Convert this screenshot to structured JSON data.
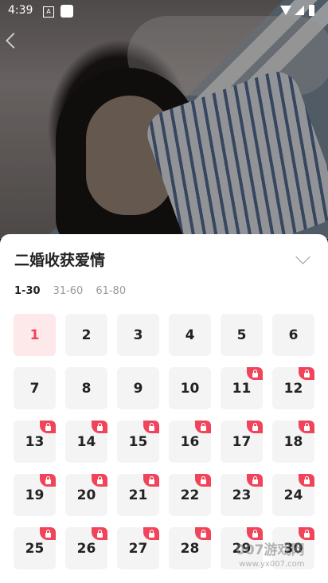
{
  "status_bar": {
    "time": "4:39",
    "a_label": "A"
  },
  "player": {},
  "sheet": {
    "title": "二婚收获爱情",
    "tabs": [
      {
        "label": "1-30",
        "active": true
      },
      {
        "label": "31-60",
        "active": false
      },
      {
        "label": "61-80",
        "active": false
      }
    ],
    "episodes": [
      {
        "label": "1",
        "locked": false,
        "current": true
      },
      {
        "label": "2",
        "locked": false,
        "current": false
      },
      {
        "label": "3",
        "locked": false,
        "current": false
      },
      {
        "label": "4",
        "locked": false,
        "current": false
      },
      {
        "label": "5",
        "locked": false,
        "current": false
      },
      {
        "label": "6",
        "locked": false,
        "current": false
      },
      {
        "label": "7",
        "locked": false,
        "current": false
      },
      {
        "label": "8",
        "locked": false,
        "current": false
      },
      {
        "label": "9",
        "locked": false,
        "current": false
      },
      {
        "label": "10",
        "locked": false,
        "current": false
      },
      {
        "label": "11",
        "locked": true,
        "current": false
      },
      {
        "label": "12",
        "locked": true,
        "current": false
      },
      {
        "label": "13",
        "locked": true,
        "current": false
      },
      {
        "label": "14",
        "locked": true,
        "current": false
      },
      {
        "label": "15",
        "locked": true,
        "current": false
      },
      {
        "label": "16",
        "locked": true,
        "current": false
      },
      {
        "label": "17",
        "locked": true,
        "current": false
      },
      {
        "label": "18",
        "locked": true,
        "current": false
      },
      {
        "label": "19",
        "locked": true,
        "current": false
      },
      {
        "label": "20",
        "locked": true,
        "current": false
      },
      {
        "label": "21",
        "locked": true,
        "current": false
      },
      {
        "label": "22",
        "locked": true,
        "current": false
      },
      {
        "label": "23",
        "locked": true,
        "current": false
      },
      {
        "label": "24",
        "locked": true,
        "current": false
      },
      {
        "label": "25",
        "locked": true,
        "current": false
      },
      {
        "label": "26",
        "locked": true,
        "current": false
      },
      {
        "label": "27",
        "locked": true,
        "current": false
      },
      {
        "label": "28",
        "locked": true,
        "current": false
      },
      {
        "label": "29",
        "locked": true,
        "current": false
      },
      {
        "label": "30",
        "locked": true,
        "current": false
      }
    ]
  },
  "watermark": {
    "line1": "007游戏网",
    "line2": "www.yx007.com"
  },
  "colors": {
    "accent": "#f0445a",
    "current_bg": "#fde8ea",
    "tile_bg": "#f4f4f4"
  }
}
